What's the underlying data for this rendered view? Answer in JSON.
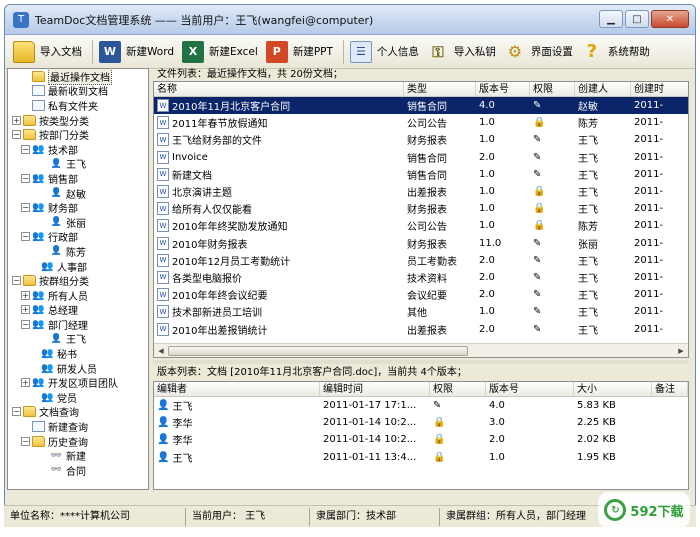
{
  "window": {
    "title": "TeamDoc文档管理系统  —— 当前用户：王飞(wangfei@computer)"
  },
  "toolbar": {
    "import_doc": "导入文档",
    "new_word": "新建Word",
    "new_excel": "新建Excel",
    "new_ppt": "新建PPT",
    "personal_info": "个人信息",
    "import_key": "导入私钥",
    "ui_settings": "界面设置",
    "help": "系统帮助"
  },
  "tree": {
    "items": [
      {
        "label": "最近操作文档",
        "icon": "folder-icon",
        "indent": 1,
        "exp": "",
        "selected": true
      },
      {
        "label": "最新收到文档",
        "icon": "doc-icon",
        "indent": 1,
        "exp": ""
      },
      {
        "label": "私有文件夹",
        "icon": "doc-icon",
        "indent": 1,
        "exp": ""
      },
      {
        "label": "按类型分类",
        "icon": "folder-icon",
        "indent": 0,
        "exp": "+"
      },
      {
        "label": "按部门分类",
        "icon": "folder-icon",
        "indent": 0,
        "exp": "-"
      },
      {
        "label": "技术部",
        "icon": "group-icon",
        "indent": 1,
        "exp": "-"
      },
      {
        "label": "王飞",
        "icon": "person-icon",
        "indent": 3,
        "exp": ""
      },
      {
        "label": "销售部",
        "icon": "group-icon",
        "indent": 1,
        "exp": "-"
      },
      {
        "label": "赵敏",
        "icon": "person-icon",
        "indent": 3,
        "exp": ""
      },
      {
        "label": "财务部",
        "icon": "group-icon",
        "indent": 1,
        "exp": "-"
      },
      {
        "label": "张丽",
        "icon": "person-icon",
        "indent": 3,
        "exp": ""
      },
      {
        "label": "行政部",
        "icon": "group-icon",
        "indent": 1,
        "exp": "-"
      },
      {
        "label": "陈芳",
        "icon": "person-icon",
        "indent": 3,
        "exp": ""
      },
      {
        "label": "人事部",
        "icon": "group-icon",
        "indent": 2,
        "exp": ""
      },
      {
        "label": "按群组分类",
        "icon": "folder-icon",
        "indent": 0,
        "exp": "-"
      },
      {
        "label": "所有人员",
        "icon": "group-icon",
        "indent": 1,
        "exp": "+"
      },
      {
        "label": "总经理",
        "icon": "group-icon",
        "indent": 1,
        "exp": "+"
      },
      {
        "label": "部门经理",
        "icon": "group-icon",
        "indent": 1,
        "exp": "-"
      },
      {
        "label": "王飞",
        "icon": "person-icon",
        "indent": 3,
        "exp": ""
      },
      {
        "label": "秘书",
        "icon": "group-icon",
        "indent": 2,
        "exp": ""
      },
      {
        "label": "研发人员",
        "icon": "group-icon",
        "indent": 2,
        "exp": ""
      },
      {
        "label": "开发区项目团队",
        "icon": "group-icon",
        "indent": 1,
        "exp": "+"
      },
      {
        "label": "党员",
        "icon": "group-icon",
        "indent": 2,
        "exp": ""
      },
      {
        "label": "文档查询",
        "icon": "folder-icon",
        "indent": 0,
        "exp": "-"
      },
      {
        "label": "新建查询",
        "icon": "doc-icon",
        "indent": 1,
        "exp": ""
      },
      {
        "label": "历史查询",
        "icon": "folder-icon",
        "indent": 1,
        "exp": "-"
      },
      {
        "label": "新建",
        "icon": "search-icon",
        "indent": 3,
        "exp": ""
      },
      {
        "label": "合同",
        "icon": "search-icon",
        "indent": 3,
        "exp": ""
      }
    ]
  },
  "file_list": {
    "caption": "文件列表：最近操作文档，共 20份文档；",
    "columns": [
      "名称",
      "类型",
      "版本号",
      "权限",
      "创建人",
      "创建时"
    ],
    "rows": [
      {
        "name": "2010年11月北京客户合同",
        "type": "销售合同",
        "version": "4.0",
        "perm": "edit",
        "creator": "赵敏",
        "created": "2011-",
        "selected": true
      },
      {
        "name": "2011年春节放假通知",
        "type": "公司公告",
        "version": "1.0",
        "perm": "lock",
        "creator": "陈芳",
        "created": "2011-"
      },
      {
        "name": "王飞给财务部的文件",
        "type": "财务报表",
        "version": "1.0",
        "perm": "edit",
        "creator": "王飞",
        "created": "2011-"
      },
      {
        "name": "Invoice",
        "type": "销售合同",
        "version": "2.0",
        "perm": "edit",
        "creator": "王飞",
        "created": "2011-"
      },
      {
        "name": "新建文档",
        "type": "销售合同",
        "version": "1.0",
        "perm": "edit",
        "creator": "王飞",
        "created": "2011-"
      },
      {
        "name": "北京演讲主题",
        "type": "出差报表",
        "version": "1.0",
        "perm": "lock",
        "creator": "王飞",
        "created": "2011-"
      },
      {
        "name": "给所有人仅仅能看",
        "type": "财务报表",
        "version": "1.0",
        "perm": "lock",
        "creator": "王飞",
        "created": "2011-"
      },
      {
        "name": "2010年年终奖励发放通知",
        "type": "公司公告",
        "version": "1.0",
        "perm": "lock",
        "creator": "陈芳",
        "created": "2011-"
      },
      {
        "name": "2010年财务报表",
        "type": "财务报表",
        "version": "11.0",
        "perm": "edit",
        "creator": "张丽",
        "created": "2011-"
      },
      {
        "name": "2010年12月员工考勤统计",
        "type": "员工考勤表",
        "version": "2.0",
        "perm": "edit",
        "creator": "王飞",
        "created": "2011-"
      },
      {
        "name": "各类型电脑报价",
        "type": "技术资料",
        "version": "2.0",
        "perm": "edit",
        "creator": "王飞",
        "created": "2011-"
      },
      {
        "name": "2010年年终会议纪要",
        "type": "会议纪要",
        "version": "2.0",
        "perm": "edit",
        "creator": "王飞",
        "created": "2011-"
      },
      {
        "name": "技术部新进员工培训",
        "type": "其他",
        "version": "1.0",
        "perm": "edit",
        "creator": "王飞",
        "created": "2011-"
      },
      {
        "name": "2010年出差报销统计",
        "type": "出差报表",
        "version": "2.0",
        "perm": "edit",
        "creator": "王飞",
        "created": "2011-"
      }
    ]
  },
  "version_list": {
    "caption": "版本列表：文档 [2010年11月北京客户合同.doc]，当前共 4个版本；",
    "columns": [
      "编辑者",
      "编辑时间",
      "权限",
      "版本号",
      "大小",
      "备注"
    ],
    "rows": [
      {
        "editor": "王飞",
        "time": "2011-01-17 17:1...",
        "perm": "edit",
        "version": "4.0",
        "size": "5.83 KB"
      },
      {
        "editor": "李华",
        "time": "2011-01-14 10:2...",
        "perm": "lock",
        "version": "3.0",
        "size": "2.25 KB"
      },
      {
        "editor": "李华",
        "time": "2011-01-14 10:2...",
        "perm": "lock",
        "version": "2.0",
        "size": "2.02 KB"
      },
      {
        "editor": "王飞",
        "time": "2011-01-11 13:4...",
        "perm": "lock",
        "version": "1.0",
        "size": "1.95 KB"
      }
    ]
  },
  "status": {
    "org": "单位名称：****计算机公司",
    "user": "当前用户：  王飞",
    "dept": "隶属部门：技术部",
    "group": "隶属群组：所有人员，部门经理"
  },
  "watermark": "592下载",
  "colors": {
    "selection": "#0a246a",
    "titlebar": "#c9d9ef",
    "window_bg": "#ece9d8"
  }
}
